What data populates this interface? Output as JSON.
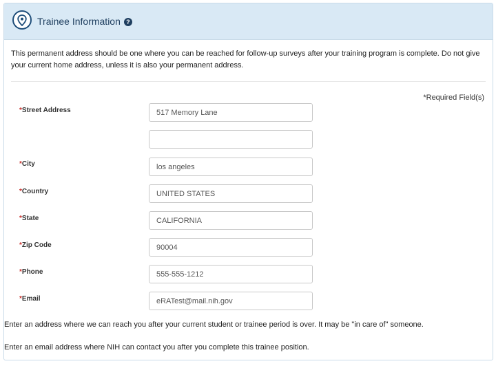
{
  "header": {
    "title": "Trainee Information",
    "pin_icon": "map-pin-icon",
    "help_icon": "question-circle-icon",
    "help_glyph": "?"
  },
  "intro_text": "This permanent address should be one where you can be reached for follow-up surveys after your training program is complete. Do not give your current home address, unless it is also your permanent address.",
  "required_note": "*Required Field(s)",
  "required_marker": "*",
  "fields": {
    "street": {
      "label": "Street Address",
      "value": "517 Memory Lane"
    },
    "street2": {
      "label": "",
      "value": ""
    },
    "city": {
      "label": "City",
      "value": "los angeles"
    },
    "country": {
      "label": "Country",
      "value": "UNITED STATES"
    },
    "state": {
      "label": "State",
      "value": "CALIFORNIA"
    },
    "zip": {
      "label": "Zip Code",
      "value": "90004"
    },
    "phone": {
      "label": "Phone",
      "value": "555-555-1212"
    },
    "email": {
      "label": "Email",
      "value": "eRATest@mail.nih.gov"
    }
  },
  "help_address": "Enter an address where we can reach you after your current student or trainee period is over. It may be \"in care of\" someone.",
  "help_email": "Enter an email address where NIH can contact you after you complete this trainee position.",
  "colors": {
    "header_bg": "#d9e9f5",
    "title": "#1f3f60",
    "required": "#c9302c"
  }
}
